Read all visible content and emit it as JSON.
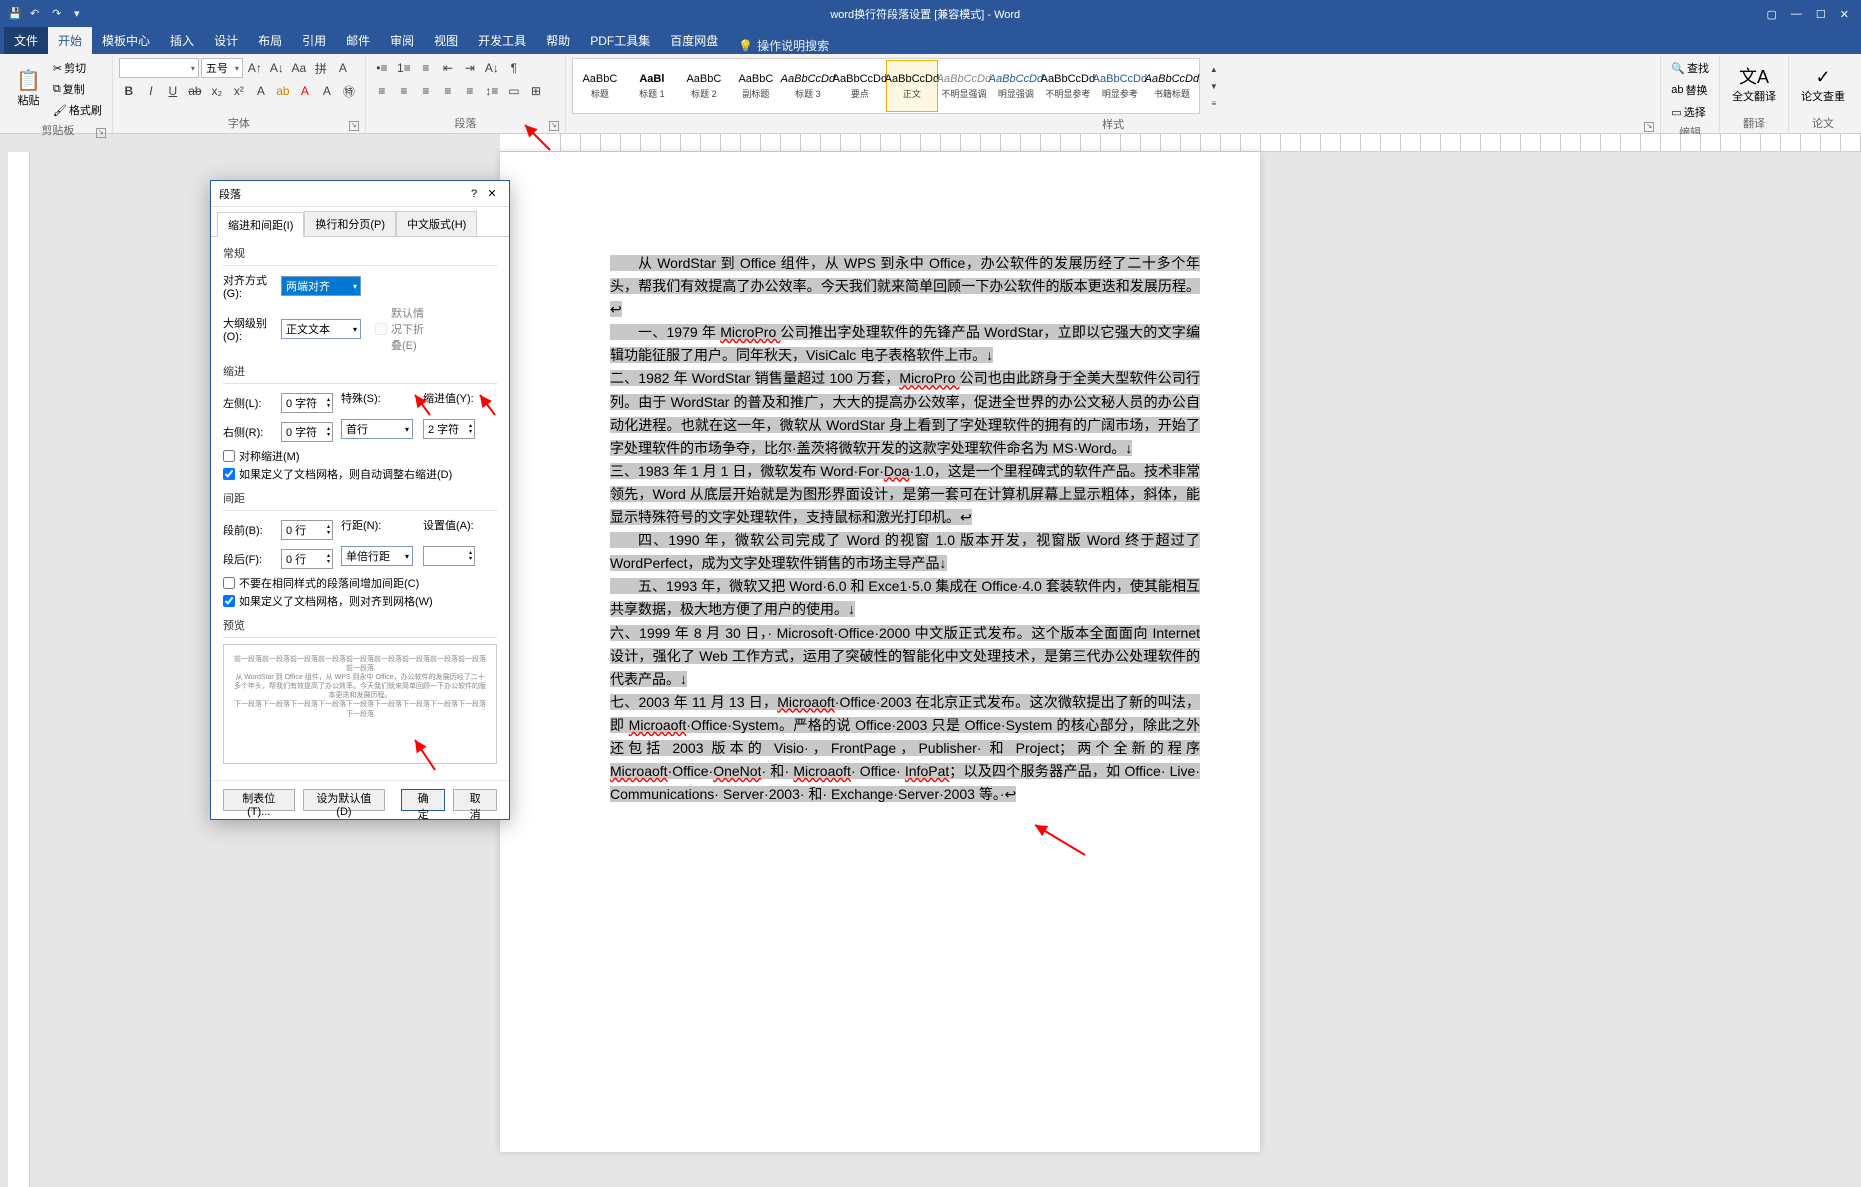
{
  "title": "word换行符段落设置 [兼容模式] - Word",
  "tabs": {
    "file": "文件",
    "home": "开始",
    "tpl": "模板中心",
    "insert": "插入",
    "design": "设计",
    "layout": "布局",
    "ref": "引用",
    "mail": "邮件",
    "review": "审阅",
    "view": "视图",
    "dev": "开发工具",
    "help": "帮助",
    "pdf": "PDF工具集",
    "baidu": "百度网盘",
    "tell": "操作说明搜索"
  },
  "ribbon": {
    "clipboard": {
      "paste": "粘贴",
      "cut": "剪切",
      "copy": "复制",
      "fmtpainter": "格式刷",
      "label": "剪贴板"
    },
    "font": {
      "name": "",
      "size": "五号",
      "label": "字体"
    },
    "para": {
      "label": "段落"
    },
    "styles": {
      "label": "样式",
      "items": [
        {
          "sample": "AaBbC",
          "name": "标题",
          "cls": ""
        },
        {
          "sample": "AaBl",
          "name": "标题 1",
          "cls": "",
          "bold": true
        },
        {
          "sample": "AaBbC",
          "name": "标题 2",
          "cls": ""
        },
        {
          "sample": "AaBbC",
          "name": "副标题",
          "cls": ""
        },
        {
          "sample": "AaBbCcDd",
          "name": "标题 3",
          "cls": "",
          "it": true
        },
        {
          "sample": "AaBbCcDd",
          "name": "要点",
          "cls": ""
        },
        {
          "sample": "AaBbCcDd",
          "name": "正文",
          "cls": "sel"
        },
        {
          "sample": "AaBbCcDd",
          "name": "不明显强调",
          "cls": "",
          "it": true,
          "gray": true
        },
        {
          "sample": "AaBbCcDd",
          "name": "明显强调",
          "cls": "",
          "it": true,
          "blue": true
        },
        {
          "sample": "AaBbCcDd",
          "name": "不明显参考",
          "cls": ""
        },
        {
          "sample": "AaBbCcDd",
          "name": "明显参考",
          "cls": "",
          "blue": true
        },
        {
          "sample": "AaBbCcDd",
          "name": "书籍标题",
          "cls": "",
          "it": true
        }
      ]
    },
    "editing": {
      "find": "查找",
      "replace": "替换",
      "select": "选择",
      "label": "编辑"
    },
    "translate": {
      "full": "全文翻译",
      "label": "翻译"
    },
    "thesis": {
      "check": "论文查重",
      "label": "论文"
    }
  },
  "doc": {
    "p1": "从 WordStar 到 Office 组件，从 WPS 到永中 Office，办公软件的发展历经了二十多个年头，帮我们有效提高了办公效率。今天我们就来简单回顾一下办公软件的版本更迭和发展历程。↩",
    "p2a": "一、1979 年 ",
    "p2b": "MicroPro ",
    "p2c": "公司推出字处理软件的先锋产品 WordStar，立即以它强大的文字编辑功能征服了用户。同年秋天，VisiCalc 电子表格软件上市。↓",
    "p3a": "二、1982 年 WordStar 销售量超过 100 万套，",
    "p3b": "MicroPro ",
    "p3c": "公司也由此跻身于全美大型软件公司行列。由于 WordStar 的普及和推广，大大的提高办公效率，促进全世界的办公文秘人员的办公自动化进程。也就在这一年，微软从 WordStar 身上看到了字处理软件的拥有的广阔市场，开始了字处理软件的市场争夺，比尔·盖茨将微软开发的这款字处理软件命名为 MS·Word。↓",
    "p4a": "三、1983 年 1 月 1 日，微软发布 Word·For·",
    "p4b": "Doa",
    "p4c": "·1.0，这是一个里程碑式的软件产品。技术非常领先，Word 从底层开始就是为图形界面设计，是第一套可在计算机屏幕上显示粗体，斜体，能显示特殊符号的文字处理软件，支持鼠标和激光打印机。↩",
    "p5": "四、1990 年，微软公司完成了 Word 的视窗 1.0 版本开发，视窗版 Word 终于超过了 WordPerfect，成为文字处理软件销售的市场主导产品↓",
    "p6": "五、1993 年，微软又把 Word·6.0 和 Exce1·5.0 集成在 Office·4.0 套装软件内，使其能相互共享数据，极大地方便了用户的使用。↓",
    "p7": "六、1999 年 8 月 30 日，· Microsoft·Office·2000 中文版正式发布。这个版本全面面向 Internet 设计，强化了 Web 工作方式，运用了突破性的智能化中文处理技术，是第三代办公处理软件的代表产品。↓",
    "p8a": "七、2003 年 11 月 13 日，",
    "p8b": "Microaoft",
    "p8c": "·Office·2003 在北京正式发布。这次微软提出了新的叫法，即 ",
    "p8d": "Microaoft",
    "p8e": "·Office·System。严格的说 Office·2003 只是 Office·System 的核心部分，除此之外还包括 2003 版本的 Visio·，FrontPage，Publisher· 和 Project；两个全新的程序 ",
    "p8f": "Microaoft",
    "p8g": "·Office·",
    "p8h": "OneNot",
    "p8i": "· 和· ",
    "p8j": "Microaoft",
    "p8k": "· Office· ",
    "p8l": "InfoPat",
    "p8m": "；以及四个服务器产品，如 Office· Live· Communications· Server·2003· 和· Exchange·Server·2003 等。·↩"
  },
  "dialog": {
    "title": "段落",
    "tabs": {
      "t1": "缩进和间距(I)",
      "t2": "换行和分页(P)",
      "t3": "中文版式(H)"
    },
    "general": "常规",
    "align_l": "对齐方式(G):",
    "align_v": "两端对齐",
    "outline_l": "大纲级别(O):",
    "outline_v": "正文文本",
    "collapse": "默认情况下折叠(E)",
    "indent": "缩进",
    "left_l": "左侧(L):",
    "left_v": "0 字符",
    "right_l": "右侧(R):",
    "right_v": "0 字符",
    "special_l": "特殊(S):",
    "special_v": "首行",
    "indval_l": "缩进值(Y):",
    "indval_v": "2 字符",
    "mirror": "对称缩进(M)",
    "autogrid": "如果定义了文档网格，则自动调整右缩进(D)",
    "spacing": "间距",
    "before_l": "段前(B):",
    "before_v": "0 行",
    "after_l": "段后(F):",
    "after_v": "0 行",
    "line_l": "行距(N):",
    "line_v": "单倍行距",
    "setval_l": "设置值(A):",
    "setval_v": "",
    "nosame": "不要在相同样式的段落间增加间距(C)",
    "snapgrid": "如果定义了文档网格，则对齐到网格(W)",
    "preview": "预览",
    "previewtext": "前一段落前一段落前一段落前一段落前一段落前一段落前一段落前一段落前一段落前一段落\n从 WordStar 到 Office 组件，从 WPS 到永中 Office，办公软件的发展历经了二十多个年头，帮我们有效提高了办公效率。今天我们就来简单回顾一下办公软件的版本更迭和发展历程。\n下一段落下一段落下一段落下一段落下一段落下一段落下一段落下一段落下一段落下一段落",
    "btn_tabs": "制表位(T)...",
    "btn_default": "设为默认值(D)",
    "btn_ok": "确定",
    "btn_cancel": "取消"
  }
}
